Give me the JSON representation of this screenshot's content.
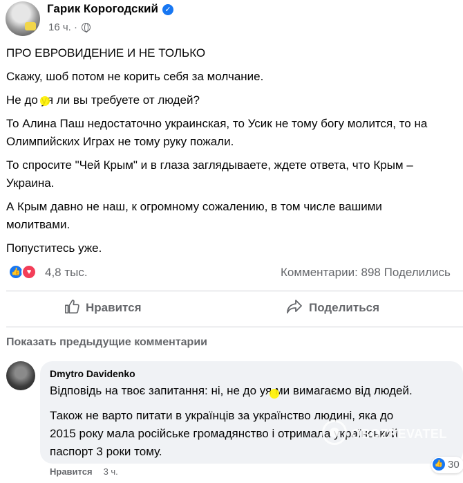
{
  "post": {
    "author": "Гарик Корогодский",
    "time": "16 ч.",
    "paragraphs": [
      "ПРО ЕВРОВИДЕНИЕ И НЕ ТОЛЬКО",
      "Скажу, шоб потом не корить себя за молчание.",
      "Не до  уя ли вы требуете от людей?",
      "То Алина Паш недостаточно украинская, то Усик не тому богу молится, то на\nОлимпийских Играх не тому руку пожали.",
      "То спросите \"Чей Крым\" и в глаза заглядываете, ждете ответа, что Крым –\nУкраина.",
      "А Крым давно не наш, к огромному сожалению, в том числе вашими\nмолитвами.",
      "Попуститесь уже."
    ]
  },
  "stats": {
    "reactions_count": "4,8 тыс.",
    "comments_share": "Комментарии: 898  Поделились"
  },
  "actions": {
    "like_label": "Нравится",
    "share_label": "Поделиться"
  },
  "comments_section": {
    "show_previous": "Показать предыдущие комментарии"
  },
  "comment": {
    "author": "Dmytro Davidenko",
    "paragraphs": [
      "Відповідь на твоє запитання: ні, не до  уя ми вимагаємо від людей.",
      "Також не варто питати в українців за українство людині, яка до\n2015 року мала російське громадянство і отримала український\nпаспорт 3 роки тому."
    ],
    "reaction_count": "30",
    "like_link": "Нравится",
    "time": "3 ч."
  },
  "watermark": {
    "text": "OBOZREVATEL"
  },
  "colors": {
    "facebook_blue": "#1877f2",
    "love_red": "#f33e58",
    "secondary_text": "#65676b",
    "bubble_bg": "#f0f2f5",
    "highlight": "#fff100"
  },
  "icons": {
    "verified": "verified-badge-icon",
    "audience": "globe-icon",
    "like": "thumbs-up-icon",
    "love": "heart-icon",
    "share": "share-arrow-icon"
  }
}
